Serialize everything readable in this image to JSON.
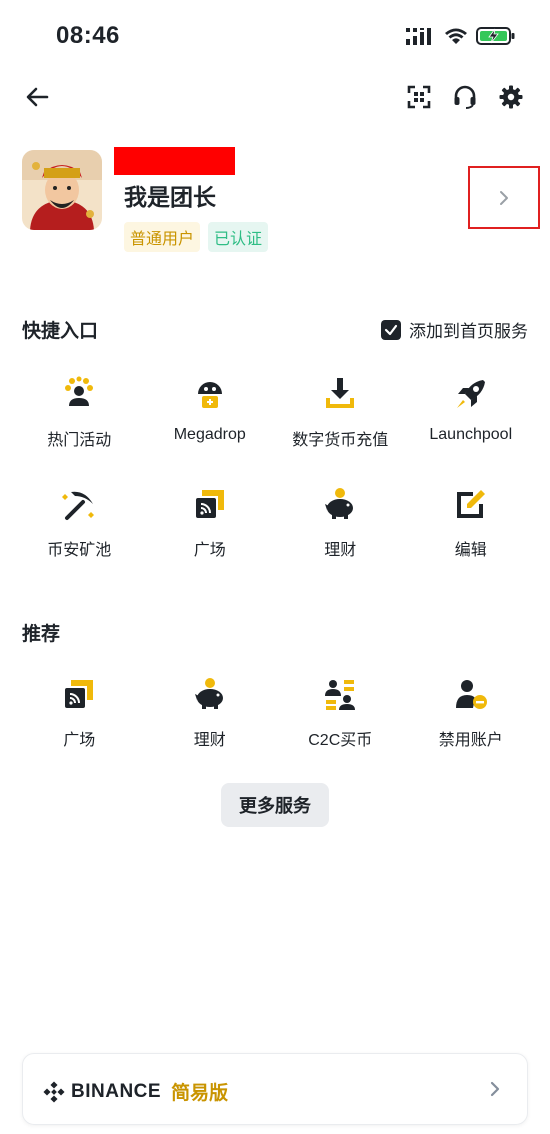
{
  "status_bar": {
    "time": "08:46",
    "icons": [
      "cellular-icon",
      "wifi-icon",
      "battery-charging-icon"
    ]
  },
  "top_bar": {
    "icons": [
      "back-arrow-icon",
      "scan-icon",
      "headset-icon",
      "settings-gear-icon"
    ]
  },
  "profile": {
    "nickname": "我是团长",
    "badges": [
      "普通用户",
      "已认证"
    ]
  },
  "shortcuts": {
    "title": "快捷入口",
    "add_to_home_label": "添加到首页服务",
    "add_to_home_checked": true,
    "items": [
      {
        "label": "热门活动",
        "icon": "hot-activity-icon"
      },
      {
        "label": "Megadrop",
        "icon": "megadrop-icon"
      },
      {
        "label": "数字货币充值",
        "icon": "deposit-icon"
      },
      {
        "label": "Launchpool",
        "icon": "rocket-icon"
      },
      {
        "label": "币安矿池",
        "icon": "pickaxe-icon"
      },
      {
        "label": "广场",
        "icon": "square-feed-icon"
      },
      {
        "label": "理财",
        "icon": "piggy-bank-icon"
      },
      {
        "label": "编辑",
        "icon": "edit-icon"
      }
    ]
  },
  "recommended": {
    "title": "推荐",
    "items": [
      {
        "label": "广场",
        "icon": "square-feed-icon"
      },
      {
        "label": "理财",
        "icon": "piggy-bank-icon"
      },
      {
        "label": "C2C买币",
        "icon": "c2c-users-icon"
      },
      {
        "label": "禁用账户",
        "icon": "disable-account-icon"
      }
    ]
  },
  "more_button": "更多服务",
  "footer": {
    "brand": "BINANCE",
    "lite_label": "简易版"
  },
  "colors": {
    "accent": "#F0B90B",
    "text": "#1E2329",
    "verified": "#2EBD85",
    "redaction": "#FF0000"
  }
}
